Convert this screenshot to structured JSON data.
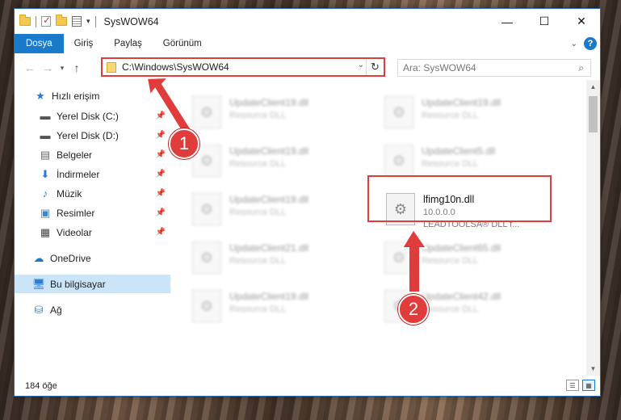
{
  "window": {
    "title": "SysWOW64",
    "controls": {
      "minimize": "—",
      "maximize": "☐",
      "close": "✕"
    }
  },
  "ribbon": {
    "tabs": [
      "Dosya",
      "Giriş",
      "Paylaş",
      "Görünüm"
    ],
    "active_tab": "Dosya",
    "help": "?"
  },
  "address": {
    "path": "C:\\Windows\\SysWOW64",
    "search_placeholder": "Ara: SysWOW64"
  },
  "sidebar": {
    "items": [
      {
        "label": "Hızlı erişim",
        "icon": "star-icon",
        "pinned": false
      },
      {
        "label": "Yerel Disk (C:)",
        "icon": "drive-icon",
        "pinned": true
      },
      {
        "label": "Yerel Disk (D:)",
        "icon": "drive-icon",
        "pinned": true
      },
      {
        "label": "Belgeler",
        "icon": "document-icon",
        "pinned": true
      },
      {
        "label": "İndirmeler",
        "icon": "download-icon",
        "pinned": true
      },
      {
        "label": "Müzik",
        "icon": "music-icon",
        "pinned": true
      },
      {
        "label": "Resimler",
        "icon": "pictures-icon",
        "pinned": true
      },
      {
        "label": "Videolar",
        "icon": "video-icon",
        "pinned": true
      },
      {
        "label": "OneDrive",
        "icon": "cloud-icon",
        "pinned": false
      },
      {
        "label": "Bu bilgisayar",
        "icon": "computer-icon",
        "pinned": false,
        "selected": true
      },
      {
        "label": "Ağ",
        "icon": "network-icon",
        "pinned": false
      }
    ]
  },
  "files": [
    {
      "name": "UpdateClient19.dll",
      "type": "Resource DLL"
    },
    {
      "name": "UpdateClient19.dll",
      "type": "Resource DLL"
    },
    {
      "name": "UpdateClient19.dll",
      "type": "Resource DLL"
    },
    {
      "name": "UpdateClient5.dll",
      "type": "Resource DLL"
    },
    {
      "name": "UpdateClient19.dll",
      "type": "Resource DLL"
    },
    {
      "name": "lfimg10n.dll",
      "version": "10.0.0.0",
      "company": "LEADTOOLSA® DLL f..."
    },
    {
      "name": "UpdateClient21.dll",
      "type": "Resource DLL"
    },
    {
      "name": "UpdateClient65.dll",
      "type": "Resource DLL"
    },
    {
      "name": "UpdateClient19.dll",
      "type": "Resource DLL"
    },
    {
      "name": "UpdateClient42.dll",
      "type": "Resource DLL"
    }
  ],
  "status": {
    "item_count": "184 öğe"
  },
  "annotations": {
    "step1": "1",
    "step2": "2",
    "color": "#e03c3c"
  }
}
